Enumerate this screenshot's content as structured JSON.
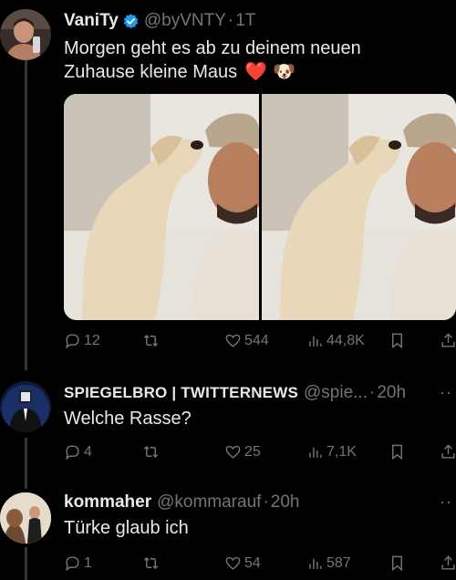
{
  "tweets": [
    {
      "name": "VaniTy",
      "handle": "@byVNTY",
      "dot": "·",
      "time": "1T",
      "text_line1": "Morgen geht es ab zu deinem neuen",
      "text_line2": "Zuhause kleine Maus",
      "emoji_heart": "❤️",
      "emoji_dog": "🐶",
      "replies": "12",
      "likes": "544",
      "views": "44,8K",
      "verified": true
    },
    {
      "name": "SPIEGELBRO | TWITTERNEWS",
      "handle": "@spie...",
      "dot": "·",
      "time": "20h",
      "text": "Welche Rasse?",
      "replies": "4",
      "likes": "25",
      "views": "7,1K"
    },
    {
      "name": "kommaher",
      "handle": "@kommarauf",
      "dot": "·",
      "time": "20h",
      "text": "Türke glaub ich",
      "replies": "1",
      "likes": "54",
      "views": "587"
    }
  ],
  "more_label": "··",
  "colors": {
    "background": "#000000",
    "text": "#e7e9ea",
    "muted": "#71767b",
    "verified": "#1d9bf0",
    "heart": "#e0245e"
  },
  "icons": [
    "reply-icon",
    "retweet-icon",
    "like-icon",
    "views-icon",
    "bookmark-icon",
    "share-icon",
    "verified-badge-icon"
  ]
}
